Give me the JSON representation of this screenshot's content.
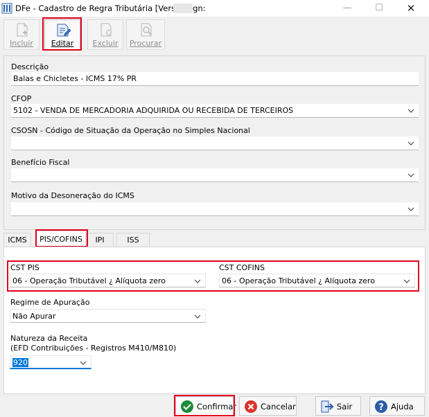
{
  "window": {
    "title": "DFe - Cadastro de Regra Tributária [Versão pgn:",
    "icon": "app-columns-icon",
    "controls": {
      "minimize": "—",
      "maximize": "☐",
      "close": "✕"
    }
  },
  "toolbar": {
    "incluir": "Incluir",
    "editar": "Editar",
    "excluir": "Excluir",
    "procurar": "Procurar"
  },
  "form": {
    "descricao_label": "Descrição",
    "descricao_value": "Balas e Chicletes  - ICMS 17% PR",
    "cfop_label": "CFOP",
    "cfop_value": "5102 - VENDA DE MERCADORIA ADQUIRIDA OU RECEBIDA DE TERCEIROS",
    "csosn_label": "CSOSN - Código de Situação da Operação no Simples Nacional",
    "csosn_value": "",
    "beneficio_label": "Benefício Fiscal",
    "beneficio_value": "",
    "motivo_label": "Motivo da Desoneração do ICMS",
    "motivo_value": ""
  },
  "tabs": [
    {
      "label": "ICMS"
    },
    {
      "label": "PIS/COFINS",
      "selected": true
    },
    {
      "label": "IPI"
    },
    {
      "label": "ISS"
    }
  ],
  "pis_cofins": {
    "cst_pis_label": "CST PIS",
    "cst_pis_value": "06 - Operação Tributável ¿ Alíquota zero",
    "cst_cofins_label": "CST COFINS",
    "cst_cofins_value": "06 - Operação Tributável ¿ Alíquota zero",
    "regime_label": "Regime de Apuração",
    "regime_value": "Não Apurar",
    "natureza_label_1": "Natureza da Receita",
    "natureza_label_2": "(EFD Contribuições - Registros M410/M810)",
    "natureza_value": "920"
  },
  "buttons": {
    "confirmar": "Confirmar",
    "cancelar": "Cancelar",
    "sair": "Sair",
    "ajuda": "Ajuda"
  },
  "colors": {
    "highlight": "#e0001b",
    "confirm_green": "#1e8a3a",
    "cancel_red": "#d9342b",
    "help_blue": "#2a5ca8",
    "selection_blue": "#0078d7"
  }
}
